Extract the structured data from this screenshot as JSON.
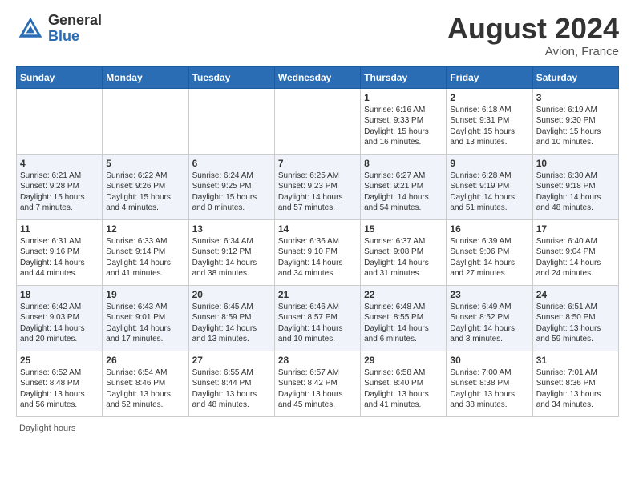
{
  "header": {
    "logo_general": "General",
    "logo_blue": "Blue",
    "month_year": "August 2024",
    "location": "Avion, France"
  },
  "days": [
    "Sunday",
    "Monday",
    "Tuesday",
    "Wednesday",
    "Thursday",
    "Friday",
    "Saturday"
  ],
  "footer": {
    "daylight_label": "Daylight hours"
  },
  "weeks": [
    [
      {
        "date": "",
        "info": ""
      },
      {
        "date": "",
        "info": ""
      },
      {
        "date": "",
        "info": ""
      },
      {
        "date": "",
        "info": ""
      },
      {
        "date": "1",
        "info": "Sunrise: 6:16 AM\nSunset: 9:33 PM\nDaylight: 15 hours and 16 minutes."
      },
      {
        "date": "2",
        "info": "Sunrise: 6:18 AM\nSunset: 9:31 PM\nDaylight: 15 hours and 13 minutes."
      },
      {
        "date": "3",
        "info": "Sunrise: 6:19 AM\nSunset: 9:30 PM\nDaylight: 15 hours and 10 minutes."
      }
    ],
    [
      {
        "date": "4",
        "info": "Sunrise: 6:21 AM\nSunset: 9:28 PM\nDaylight: 15 hours and 7 minutes."
      },
      {
        "date": "5",
        "info": "Sunrise: 6:22 AM\nSunset: 9:26 PM\nDaylight: 15 hours and 4 minutes."
      },
      {
        "date": "6",
        "info": "Sunrise: 6:24 AM\nSunset: 9:25 PM\nDaylight: 15 hours and 0 minutes."
      },
      {
        "date": "7",
        "info": "Sunrise: 6:25 AM\nSunset: 9:23 PM\nDaylight: 14 hours and 57 minutes."
      },
      {
        "date": "8",
        "info": "Sunrise: 6:27 AM\nSunset: 9:21 PM\nDaylight: 14 hours and 54 minutes."
      },
      {
        "date": "9",
        "info": "Sunrise: 6:28 AM\nSunset: 9:19 PM\nDaylight: 14 hours and 51 minutes."
      },
      {
        "date": "10",
        "info": "Sunrise: 6:30 AM\nSunset: 9:18 PM\nDaylight: 14 hours and 48 minutes."
      }
    ],
    [
      {
        "date": "11",
        "info": "Sunrise: 6:31 AM\nSunset: 9:16 PM\nDaylight: 14 hours and 44 minutes."
      },
      {
        "date": "12",
        "info": "Sunrise: 6:33 AM\nSunset: 9:14 PM\nDaylight: 14 hours and 41 minutes."
      },
      {
        "date": "13",
        "info": "Sunrise: 6:34 AM\nSunset: 9:12 PM\nDaylight: 14 hours and 38 minutes."
      },
      {
        "date": "14",
        "info": "Sunrise: 6:36 AM\nSunset: 9:10 PM\nDaylight: 14 hours and 34 minutes."
      },
      {
        "date": "15",
        "info": "Sunrise: 6:37 AM\nSunset: 9:08 PM\nDaylight: 14 hours and 31 minutes."
      },
      {
        "date": "16",
        "info": "Sunrise: 6:39 AM\nSunset: 9:06 PM\nDaylight: 14 hours and 27 minutes."
      },
      {
        "date": "17",
        "info": "Sunrise: 6:40 AM\nSunset: 9:04 PM\nDaylight: 14 hours and 24 minutes."
      }
    ],
    [
      {
        "date": "18",
        "info": "Sunrise: 6:42 AM\nSunset: 9:03 PM\nDaylight: 14 hours and 20 minutes."
      },
      {
        "date": "19",
        "info": "Sunrise: 6:43 AM\nSunset: 9:01 PM\nDaylight: 14 hours and 17 minutes."
      },
      {
        "date": "20",
        "info": "Sunrise: 6:45 AM\nSunset: 8:59 PM\nDaylight: 14 hours and 13 minutes."
      },
      {
        "date": "21",
        "info": "Sunrise: 6:46 AM\nSunset: 8:57 PM\nDaylight: 14 hours and 10 minutes."
      },
      {
        "date": "22",
        "info": "Sunrise: 6:48 AM\nSunset: 8:55 PM\nDaylight: 14 hours and 6 minutes."
      },
      {
        "date": "23",
        "info": "Sunrise: 6:49 AM\nSunset: 8:52 PM\nDaylight: 14 hours and 3 minutes."
      },
      {
        "date": "24",
        "info": "Sunrise: 6:51 AM\nSunset: 8:50 PM\nDaylight: 13 hours and 59 minutes."
      }
    ],
    [
      {
        "date": "25",
        "info": "Sunrise: 6:52 AM\nSunset: 8:48 PM\nDaylight: 13 hours and 56 minutes."
      },
      {
        "date": "26",
        "info": "Sunrise: 6:54 AM\nSunset: 8:46 PM\nDaylight: 13 hours and 52 minutes."
      },
      {
        "date": "27",
        "info": "Sunrise: 6:55 AM\nSunset: 8:44 PM\nDaylight: 13 hours and 48 minutes."
      },
      {
        "date": "28",
        "info": "Sunrise: 6:57 AM\nSunset: 8:42 PM\nDaylight: 13 hours and 45 minutes."
      },
      {
        "date": "29",
        "info": "Sunrise: 6:58 AM\nSunset: 8:40 PM\nDaylight: 13 hours and 41 minutes."
      },
      {
        "date": "30",
        "info": "Sunrise: 7:00 AM\nSunset: 8:38 PM\nDaylight: 13 hours and 38 minutes."
      },
      {
        "date": "31",
        "info": "Sunrise: 7:01 AM\nSunset: 8:36 PM\nDaylight: 13 hours and 34 minutes."
      }
    ]
  ]
}
